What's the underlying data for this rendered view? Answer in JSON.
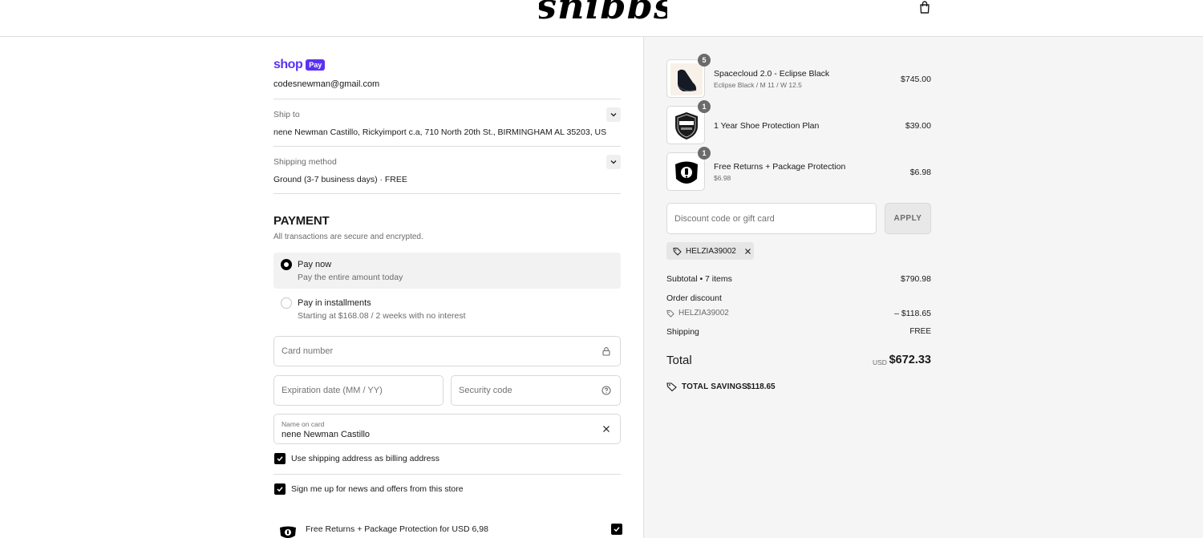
{
  "header": {
    "logo": "snibbs",
    "bag_icon": "shopping-bag-icon"
  },
  "shop_pay": {
    "shop": "shop",
    "pay": "Pay",
    "email": "codesnewman@gmail.com"
  },
  "ship_to": {
    "label": "Ship to",
    "value": "nene Newman Castillo, Rickyimport c.a, 710 North 20th St., BIRMINGHAM AL 35203, US"
  },
  "shipping_method": {
    "label": "Shipping method",
    "value": "Ground (3-7 business days) · FREE"
  },
  "payment": {
    "title": "PAYMENT",
    "subtitle": "All transactions are secure and encrypted.",
    "options": [
      {
        "title": "Pay now",
        "desc": "Pay the entire amount today",
        "selected": true
      },
      {
        "title": "Pay in installments",
        "desc": "Starting at $168.08 / 2 weeks with no interest",
        "selected": false
      }
    ],
    "card_number_placeholder": "Card number",
    "expiration_placeholder": "Expiration date (MM / YY)",
    "security_placeholder": "Security code",
    "name_label": "Name on card",
    "name_value": "nene Newman Castillo",
    "billing_checkbox": "Use shipping address as billing address",
    "news_checkbox": "Sign me up for news and offers from this store",
    "protection_label": "Free Returns + Package Protection for USD 6,98"
  },
  "summary": {
    "items": [
      {
        "name": "Spacecloud 2.0 - Eclipse Black",
        "variant": "Eclipse Black / M 11 / W 12.5",
        "price": "$745.00",
        "qty": "5"
      },
      {
        "name": "1 Year Shoe Protection Plan",
        "variant": "",
        "price": "$39.00",
        "qty": "1"
      },
      {
        "name": "Free Returns + Package Protection",
        "variant": "$6.98",
        "price": "$6.98",
        "qty": "1"
      }
    ],
    "discount_placeholder": "Discount code or gift card",
    "apply_label": "APPLY",
    "applied_code": "HELZIA39002",
    "subtotal_label": "Subtotal • 7 items",
    "subtotal_value": "$790.98",
    "order_discount_label": "Order discount",
    "discount_code": "HELZIA39002",
    "discount_value": "– $118.65",
    "shipping_label": "Shipping",
    "shipping_value": "FREE",
    "total_label": "Total",
    "currency": "USD",
    "total_value": "$672.33",
    "savings_label": "TOTAL SAVINGS",
    "savings_value": "$118.65"
  }
}
